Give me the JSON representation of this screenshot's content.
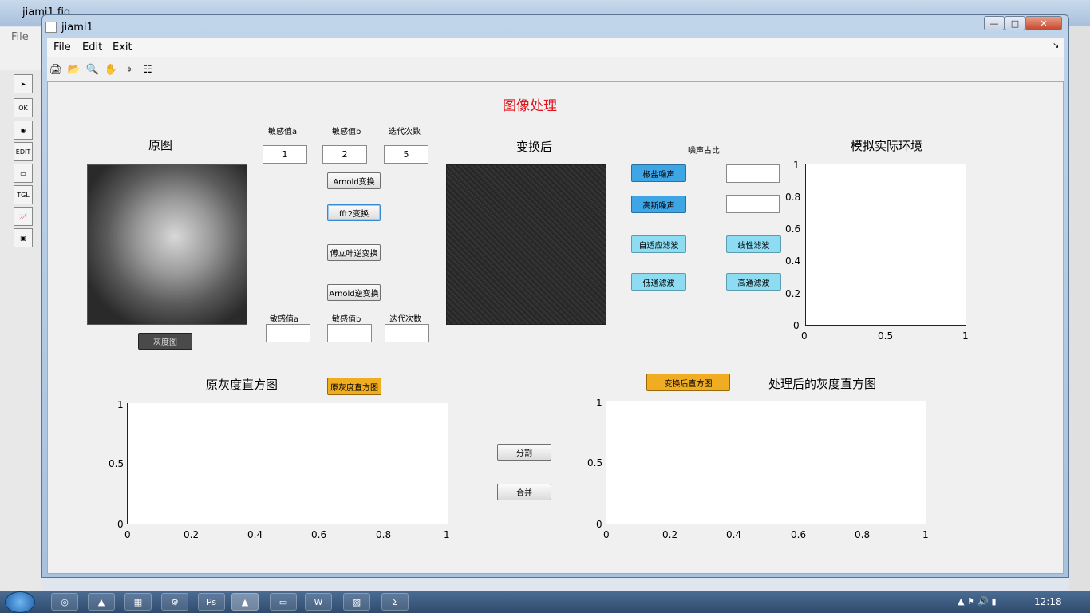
{
  "background_window": {
    "title": "jiami1.fig",
    "menu": "File"
  },
  "window": {
    "title": "jiami1",
    "min": "—",
    "max": "□",
    "close": "✕"
  },
  "menubar": [
    "File",
    "Edit",
    "Exit"
  ],
  "menubar_arrow": "↘",
  "toolbar_icons": [
    "print-icon",
    "open-folder-icon",
    "zoom-icon",
    "pan-hand-icon",
    "data-cursor-icon",
    "insert-legend-icon"
  ],
  "heading": "图像处理",
  "labels": {
    "original": "原图",
    "transformed": "变换后",
    "simulate": "模拟实际环境",
    "noise_ratio": "噪声占比",
    "orig_hist": "原灰度直方图",
    "proc_hist": "处理后的灰度直方图",
    "sens_a_top": "敏感值a",
    "sens_b_top": "敏感值b",
    "iter_top": "迭代次数",
    "sens_a_bot": "敏感值a",
    "sens_b_bot": "敏感值b",
    "iter_bot": "迭代次数"
  },
  "inputs": {
    "a_top": "1",
    "b_top": "2",
    "iter_top": "5",
    "a_bot": "",
    "b_bot": "",
    "iter_bot": "",
    "noise_salt": "",
    "noise_gauss": ""
  },
  "buttons": {
    "arnold": "Arnold变换",
    "fft2": "fft2变换",
    "ifft": "傅立叶逆变换",
    "arnold_inv": "Arnold逆变换",
    "gray": "灰度图",
    "orig_hist": "原灰度直方图",
    "trans_hist": "变换后直方图",
    "salt": "椒盐噪声",
    "gauss": "高斯噪声",
    "adaptive": "自适应滤波",
    "linear": "线性滤波",
    "lowpass": "低通滤波",
    "highpass": "高通滤波",
    "split": "分割",
    "merge": "合并"
  },
  "axes_sim": {
    "y_ticks": [
      "1",
      "0.8",
      "0.6",
      "0.4",
      "0.2",
      "0"
    ],
    "x_ticks": [
      "0",
      "0.5",
      "1"
    ]
  },
  "axes_orig_hist": {
    "y_ticks": [
      "1",
      "0.5",
      "0"
    ],
    "x_ticks": [
      "0",
      "0.2",
      "0.4",
      "0.6",
      "0.8",
      "1"
    ]
  },
  "axes_proc_hist": {
    "y_ticks": [
      "1",
      "0.5",
      "0"
    ],
    "x_ticks": [
      "0",
      "0.2",
      "0.4",
      "0.6",
      "0.8",
      "1"
    ]
  },
  "taskbar": {
    "clock": "12:18",
    "apps": [
      "chrome-icon",
      "acrobat-icon",
      "office-icon",
      "tool-icon",
      "photoshop-icon",
      "matlab-icon",
      "explorer-icon",
      "word-icon",
      "paint-icon",
      "sigma-icon"
    ]
  },
  "colors": {
    "heading": "#e0141e",
    "blue_btn": "#3fa6e6",
    "cyan_btn": "#8ddcf2",
    "orange_btn": "#f0ad22"
  }
}
